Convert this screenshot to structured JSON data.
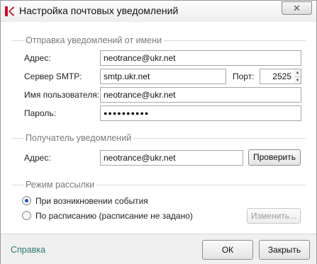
{
  "window": {
    "title": "Настройка почтовых уведомлений",
    "close_glyph": "✕"
  },
  "sender": {
    "heading": "Отправка уведомлений от имени",
    "address_label": "Адрес:",
    "address_value": "neotrance@ukr.net",
    "smtp_label": "Сервер SMTP:",
    "smtp_value": "smtp.ukr.net",
    "port_label": "Порт:",
    "port_value": "2525",
    "user_label": "Имя пользователя:",
    "user_value": "neotrance@ukr.net",
    "password_label": "Пароль:",
    "password_value": "●●●●●●●●●●"
  },
  "recipient": {
    "heading": "Получатель уведомлений",
    "address_label": "Адрес:",
    "address_value": "neotrance@ukr.net",
    "check_button": "Проверить"
  },
  "mode": {
    "heading": "Режим рассылки",
    "on_event_label": "При возникновении события",
    "on_event_selected": true,
    "schedule_label": "По расписанию (расписание не задано)",
    "schedule_selected": false,
    "change_button": "Изменить..."
  },
  "footer": {
    "help_link": "Справка",
    "ok_button": "ОК",
    "close_button": "Закрыть"
  },
  "colors": {
    "accent": "#1f5aa6",
    "help_link": "#2d7a6e",
    "section_text": "#7a7a7a"
  }
}
